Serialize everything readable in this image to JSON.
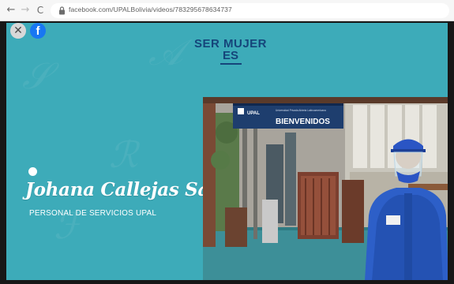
{
  "browser": {
    "url": "facebook.com/UPALBolivia/videos/783295678634737",
    "back_icon": "back-arrow-icon",
    "forward_icon": "forward-arrow-icon",
    "reload_icon": "reload-icon",
    "lock_icon": "lock-icon"
  },
  "viewer": {
    "close_icon": "close-icon",
    "facebook_icon": "facebook-icon",
    "facebook_glyph": "f",
    "close_glyph": "✕"
  },
  "slide": {
    "title_line1": "SER MUJER",
    "title_line2": "ES",
    "person_name": "Johana Callejas Saravia",
    "person_role": "PERSONAL DE SERVICIOS UPAL",
    "background_color": "#3dabb9",
    "title_color": "#15457a"
  },
  "photo": {
    "sign_logo": "UPAL",
    "sign_subtitle": "Universidad Privada Abierta Latinoamericana",
    "sign_text": "BIENVENIDOS"
  }
}
